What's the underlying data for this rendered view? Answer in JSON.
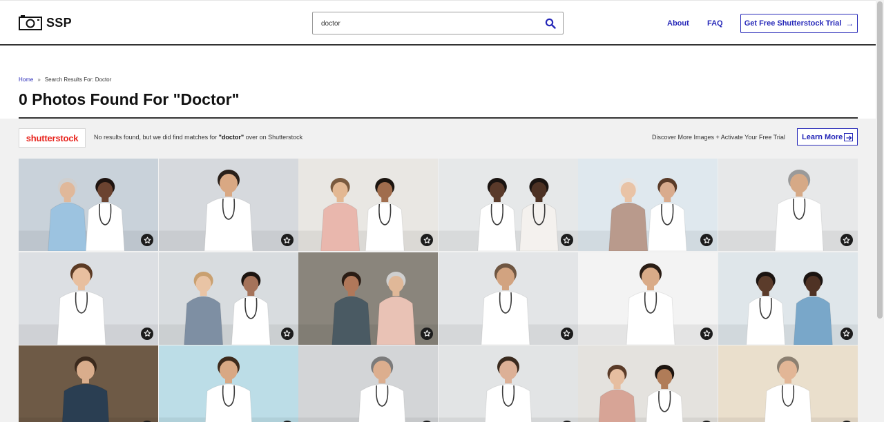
{
  "header": {
    "logo_text": "SSP",
    "search_value": "doctor",
    "nav": [
      "About",
      "FAQ"
    ],
    "trial_label": "Get Free Shutterstock Trial",
    "trial_arrow": "→"
  },
  "breadcrumb": {
    "home": "Home",
    "separator": "»",
    "current": "Search Results For: Doctor"
  },
  "title": "0 Photos Found For \"Doctor\"",
  "shutterstock": {
    "logo_text": "shutterstock",
    "notice_before": "No results found, but we did find matches for ",
    "notice_term": "\"doctor\"",
    "notice_after": " over on Shutterstock",
    "discover": "Discover More Images + Activate Your Free Trial",
    "learn_more": "Learn More"
  },
  "colors": {
    "accent": "#2527b8",
    "shutterstock_red": "#e8251e",
    "band": "#f1f1f1"
  },
  "tiles": [
    {
      "bg": "#c9d2da",
      "subjects": [
        {
          "x": 0.35,
          "coat": "#9cc3e0",
          "skin": "#e0b89a",
          "hair": "#cfcfcf"
        },
        {
          "x": 0.62,
          "coat": "#ffffff",
          "skin": "#6b4330",
          "hair": "#1e1410"
        }
      ]
    },
    {
      "bg": "#d6d9dd",
      "subjects": [
        {
          "x": 0.5,
          "coat": "#ffffff",
          "skin": "#d9a883",
          "hair": "#2a201a"
        }
      ]
    },
    {
      "bg": "#e9e7e3",
      "subjects": [
        {
          "x": 0.3,
          "coat": "#e9b7ad",
          "skin": "#e3b893",
          "hair": "#7a5a3e"
        },
        {
          "x": 0.62,
          "coat": "#ffffff",
          "skin": "#a06d4d",
          "hair": "#1b140f"
        }
      ]
    },
    {
      "bg": "#e6e8e9",
      "subjects": [
        {
          "x": 0.42,
          "coat": "#ffffff",
          "skin": "#5a3a2a",
          "hair": "#1a1411"
        },
        {
          "x": 0.72,
          "coat": "#f4f1ee",
          "skin": "#4d3224",
          "hair": "#1a1411"
        }
      ]
    },
    {
      "bg": "#dfe8ee",
      "subjects": [
        {
          "x": 0.36,
          "coat": "#b99a8c",
          "skin": "#e9c3a6",
          "hair": "#e6e6e6"
        },
        {
          "x": 0.64,
          "coat": "#ffffff",
          "skin": "#d9ab8d",
          "hair": "#5a3b28"
        }
      ]
    },
    {
      "bg": "#e7e8e9",
      "subjects": [
        {
          "x": 0.58,
          "coat": "#ffffff",
          "skin": "#d6a986",
          "hair": "#9a9a9a"
        }
      ]
    },
    {
      "bg": "#dcdfe3",
      "subjects": [
        {
          "x": 0.45,
          "coat": "#ffffff",
          "skin": "#e8bf9f",
          "hair": "#5b3a24"
        }
      ]
    },
    {
      "bg": "#d8dcdf",
      "subjects": [
        {
          "x": 0.32,
          "coat": "#7e8fa3",
          "skin": "#e9c4a5",
          "hair": "#c9a070"
        },
        {
          "x": 0.66,
          "coat": "#ffffff",
          "skin": "#a5735a",
          "hair": "#1c1410"
        }
      ]
    },
    {
      "bg": "#8a857c",
      "subjects": [
        {
          "x": 0.38,
          "coat": "#4a5a63",
          "skin": "#b0785a",
          "hair": "#2a1c14"
        },
        {
          "x": 0.7,
          "coat": "#e9c2b5",
          "skin": "#e0b898",
          "hair": "#cfcfcf"
        }
      ]
    },
    {
      "bg": "#e3e5e7",
      "subjects": [
        {
          "x": 0.48,
          "coat": "#ffffff",
          "skin": "#d2a380",
          "hair": "#6f5642"
        }
      ]
    },
    {
      "bg": "#f3f3f3",
      "subjects": [
        {
          "x": 0.52,
          "coat": "#ffffff",
          "skin": "#d9ab88",
          "hair": "#2a1d15"
        }
      ]
    },
    {
      "bg": "#dfe6ea",
      "subjects": [
        {
          "x": 0.34,
          "coat": "#ffffff",
          "skin": "#5b3c2b",
          "hair": "#1b1411"
        },
        {
          "x": 0.68,
          "coat": "#79a7c9",
          "skin": "#4f3224",
          "hair": "#1b1411"
        }
      ]
    },
    {
      "bg": "#6e5a46",
      "subjects": [
        {
          "x": 0.48,
          "coat": "#2a3e52",
          "skin": "#d9ad8c",
          "hair": "#3b2a1d"
        }
      ]
    },
    {
      "bg": "#bcdde7",
      "subjects": [
        {
          "x": 0.5,
          "coat": "#ffffff",
          "skin": "#d8a884",
          "hair": "#3d2a1c"
        }
      ]
    },
    {
      "bg": "#d3d5d7",
      "subjects": [
        {
          "x": 0.6,
          "coat": "#ffffff",
          "skin": "#dcae8e",
          "hair": "#7b7b7b"
        }
      ]
    },
    {
      "bg": "#e2e4e5",
      "subjects": [
        {
          "x": 0.5,
          "coat": "#ffffff",
          "skin": "#dcb096",
          "hair": "#3a2a1e"
        }
      ]
    },
    {
      "bg": "#e4e2de",
      "subjects": [
        {
          "x": 0.28,
          "coat": "#d7a496",
          "skin": "#e6bea0",
          "hair": "#5a3b28"
        },
        {
          "x": 0.62,
          "coat": "#ffffff",
          "skin": "#b07c58",
          "hair": "#1c140f"
        }
      ]
    },
    {
      "bg": "#eadfcc",
      "subjects": [
        {
          "x": 0.5,
          "coat": "#ffffff",
          "skin": "#e2b696",
          "hair": "#8c8071"
        }
      ]
    }
  ]
}
